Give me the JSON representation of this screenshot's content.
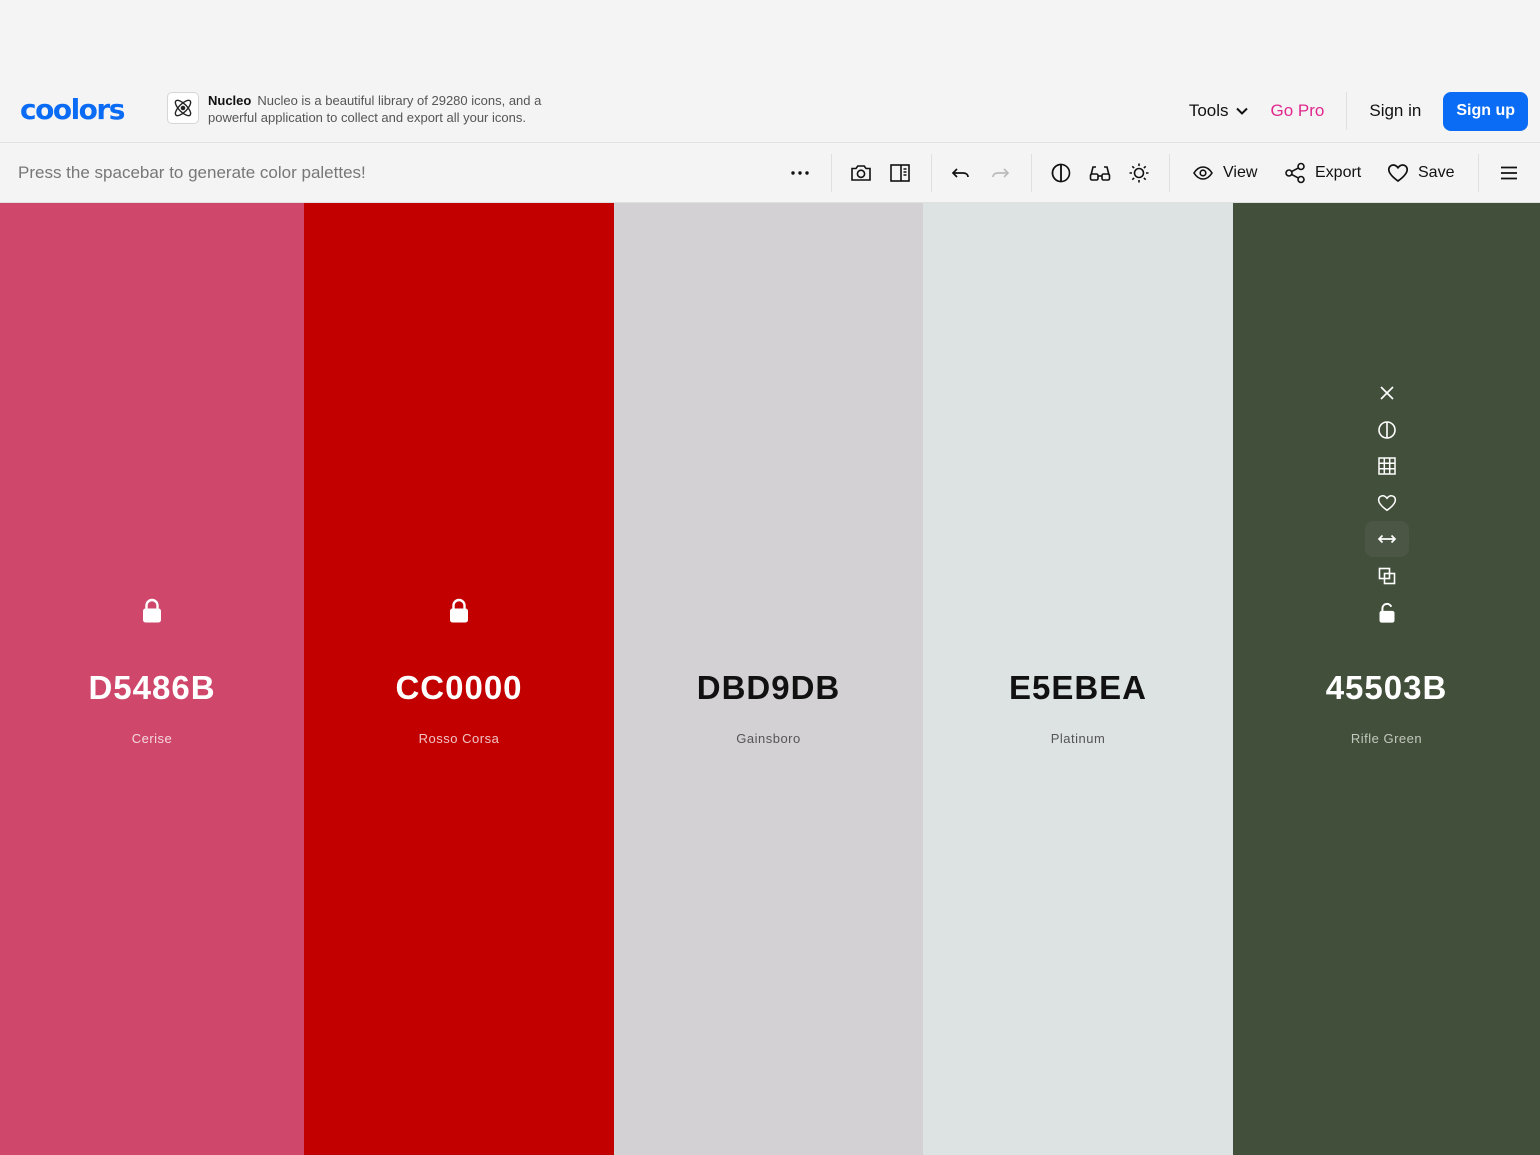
{
  "header": {
    "logo": "coolors",
    "ad": {
      "title": "Nucleo",
      "text": "Nucleo is a beautiful library of 29280 icons, and a powerful application to collect and export all your icons.",
      "icon": "atom-icon"
    },
    "tools_label": "Tools",
    "gopro_label": "Go Pro",
    "signin_label": "Sign in",
    "signup_label": "Sign up"
  },
  "toolbar": {
    "hint": "Press the spacebar to generate color palettes!",
    "view_label": "View",
    "export_label": "Export",
    "save_label": "Save",
    "icons": [
      "more-icon",
      "camera-icon",
      "sidebar-panel-icon",
      "undo-icon",
      "redo-icon",
      "contrast-icon",
      "glasses-icon",
      "sun-icon",
      "eye-icon",
      "share-icon",
      "heart-icon",
      "menu-icon"
    ]
  },
  "palette": [
    {
      "hex": "D5486B",
      "name": "Cerise",
      "bg": "#cf486b",
      "fg": "#ffffff",
      "sub": "#f6d7df",
      "locked": true
    },
    {
      "hex": "CC0000",
      "name": "Rosso Corsa",
      "bg": "#c20000",
      "fg": "#ffffff",
      "sub": "#f1c4c4",
      "locked": true
    },
    {
      "hex": "DBD9DB",
      "name": "Gainsboro",
      "bg": "#d3d1d3",
      "fg": "#111111",
      "sub": "#555555",
      "locked": false
    },
    {
      "hex": "E5EBEA",
      "name": "Platinum",
      "bg": "#dde3e2",
      "fg": "#111111",
      "sub": "#555555",
      "locked": false
    },
    {
      "hex": "45503B",
      "name": "Rifle Green",
      "bg": "#424f3a",
      "fg": "#ffffff",
      "sub": "#c3c9be",
      "locked": false
    }
  ],
  "column_tools": [
    "close-icon",
    "contrast-icon",
    "grid-icon",
    "heart-icon",
    "drag-horizontal-icon",
    "copy-icon",
    "unlock-icon"
  ],
  "accent": "#0a6cf5",
  "pro_color": "#e0288d"
}
